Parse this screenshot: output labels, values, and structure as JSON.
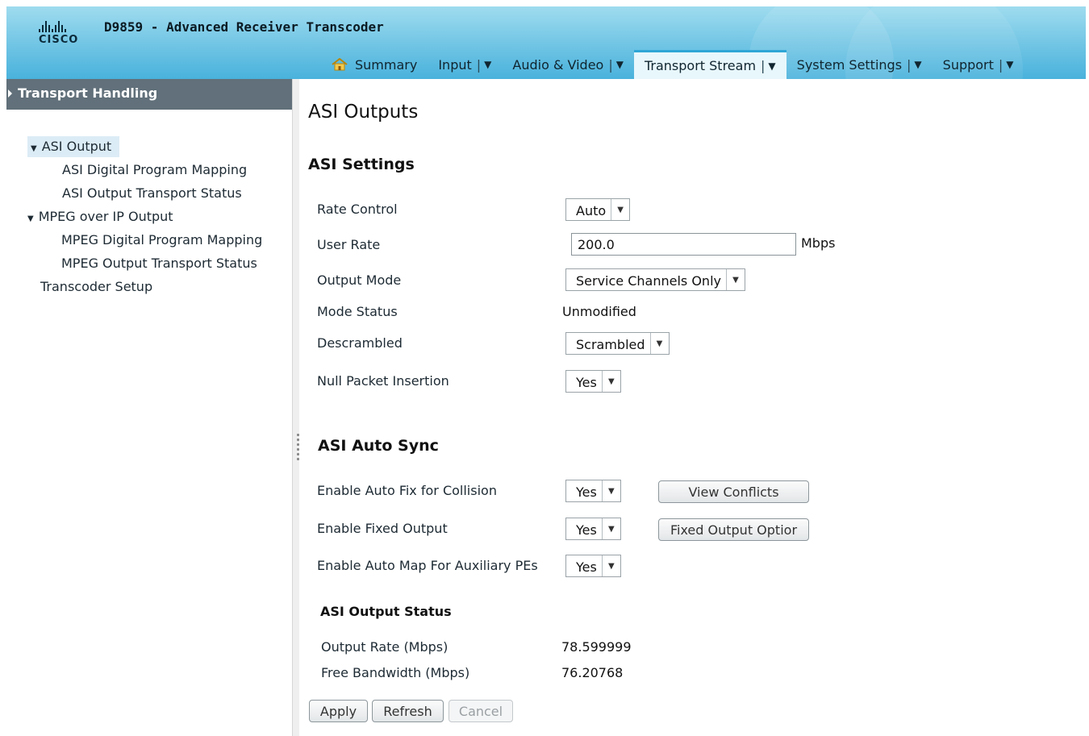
{
  "header": {
    "brand": "CISCO",
    "app_title": "D9859 - Advanced Receiver Transcoder"
  },
  "nav": {
    "items": [
      {
        "label": "Summary",
        "icon": "home-icon"
      },
      {
        "label": "Input"
      },
      {
        "label": "Audio & Video"
      },
      {
        "label": "Transport Stream",
        "active": true
      },
      {
        "label": "System Settings"
      },
      {
        "label": "Support"
      }
    ],
    "separator": "|",
    "caret": "▼"
  },
  "sidebar": {
    "title": "Transport Handling",
    "items": [
      {
        "label": "ASI Output",
        "expander": "▼",
        "selected": true
      },
      {
        "label": "ASI Digital Program Mapping"
      },
      {
        "label": "ASI Output Transport Status"
      },
      {
        "label": "MPEG over IP Output",
        "expander": "▼"
      },
      {
        "label": "MPEG Digital Program Mapping"
      },
      {
        "label": "MPEG Output Transport Status"
      },
      {
        "label": "Transcoder Setup"
      }
    ]
  },
  "main": {
    "page_title": "ASI Outputs",
    "asi_settings": {
      "title": "ASI Settings",
      "rate_control": {
        "label": "Rate Control",
        "value": "Auto"
      },
      "user_rate": {
        "label": "User Rate",
        "value": "200.0",
        "unit": "Mbps"
      },
      "output_mode": {
        "label": "Output Mode",
        "value": "Service Channels Only"
      },
      "mode_status": {
        "label": "Mode Status",
        "value": "Unmodified"
      },
      "descrambled": {
        "label": "Descrambled",
        "value": "Scrambled"
      },
      "null_packet": {
        "label": "Null Packet Insertion",
        "value": "Yes"
      }
    },
    "auto_sync": {
      "title": "ASI Auto Sync",
      "auto_fix": {
        "label": "Enable Auto Fix for Collision",
        "value": "Yes",
        "button": "View Conflicts"
      },
      "fixed_output": {
        "label": "Enable Fixed Output",
        "value": "Yes",
        "button": "Fixed Output Optior"
      },
      "auto_map": {
        "label": "Enable Auto Map For Auxiliary PEs",
        "value": "Yes"
      }
    },
    "output_status": {
      "title": "ASI Output Status",
      "output_rate": {
        "label": "Output Rate (Mbps)",
        "value": "78.599999"
      },
      "free_bandwidth": {
        "label": "Free Bandwidth (Mbps)",
        "value": "76.20768"
      }
    },
    "buttons": {
      "apply": "Apply",
      "refresh": "Refresh",
      "cancel": "Cancel"
    }
  },
  "colors": {
    "header_gradient_top": "#9fdcef",
    "header_gradient_bottom": "#49b2dc",
    "sidebar_title_bg": "#61707a",
    "selected_row_bg": "#dcecf6",
    "active_tab_border": "#2fa6d6"
  }
}
